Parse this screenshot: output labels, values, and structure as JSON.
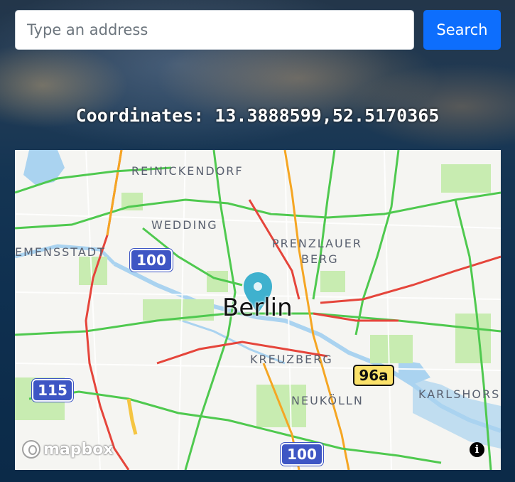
{
  "search": {
    "placeholder": "Type an address",
    "value": "",
    "button_label": "Search"
  },
  "coordinates": {
    "text": "Coordinates: 13.3888599,52.5170365",
    "lng": 13.3888599,
    "lat": 52.5170365
  },
  "map": {
    "provider": "mapbox",
    "logo_text": "mapbox",
    "info_icon": "i",
    "marker_color": "#3fb1ce",
    "city": "Berlin",
    "districts": [
      "REINICKENDORF",
      "WEDDING",
      "EMENSSTADT",
      "PRENZLAUER",
      "BERG",
      "KREUZBERG",
      "NEUKÖLLN",
      "KARLSHORS"
    ],
    "shields": {
      "a100_top": "100",
      "a115": "115",
      "a100_bottom": "100",
      "b96a": "96a"
    },
    "traffic_colors": {
      "free": "#4fc94f",
      "moderate": "#f5a623",
      "heavy": "#e5453b"
    },
    "water_color": "#aad3f0",
    "park_color": "#c8ecb1"
  }
}
